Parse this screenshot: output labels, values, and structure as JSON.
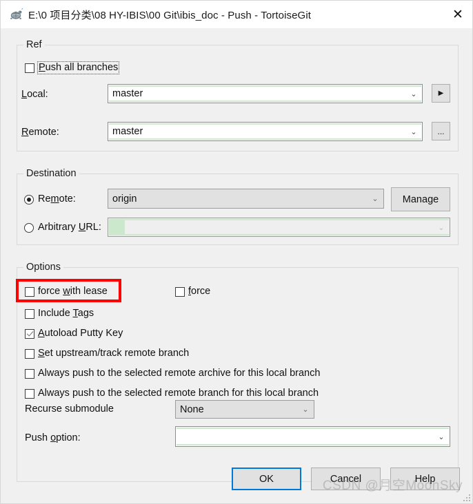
{
  "window": {
    "title": "E:\\0 项目分类\\08 HY-IBIS\\00 Git\\ibis_doc - Push - TortoiseGit",
    "app_icon": "tortoisegit-turtle-icon",
    "close_label": "✕"
  },
  "ref_group": {
    "title": "Ref",
    "push_all_branches": {
      "label": "Push all branches",
      "accel": "P",
      "checked": false,
      "focused": true
    },
    "local": {
      "label": "Local:",
      "accel": "L",
      "value": "master",
      "arrow": "⌄"
    },
    "local_browse_button": {
      "glyph": "▶",
      "name": "local-branch-picker-button"
    },
    "remote": {
      "label": "Remote:",
      "accel": "R",
      "value": "master",
      "arrow": "⌄"
    },
    "remote_browse_button": {
      "glyph": "...",
      "name": "remote-branch-browse-button"
    }
  },
  "destination_group": {
    "title": "Destination",
    "remote_radio": {
      "label": "Remote:",
      "accel": "m",
      "selected": true
    },
    "remote_combo": {
      "value": "origin",
      "arrow": "⌄",
      "disabled": true
    },
    "manage_button": {
      "label": "Manage",
      "accel": "g"
    },
    "arbitrary_url_radio": {
      "label": "Arbitrary URL:",
      "accel": "U",
      "selected": false
    },
    "arbitrary_url_combo": {
      "value": "",
      "arrow": "⌄",
      "disabled": true
    }
  },
  "options_group": {
    "title": "Options",
    "checkboxes": [
      {
        "label": "force with lease",
        "accel": "w",
        "checked": false,
        "highlighted": true
      },
      {
        "label": "force",
        "accel": "f",
        "checked": false,
        "highlighted": false
      },
      {
        "label": "Include Tags",
        "accel": "T",
        "checked": false,
        "highlighted": false
      },
      {
        "label": "Autoload Putty Key",
        "accel": "A",
        "checked": true,
        "highlighted": false
      },
      {
        "label": "Set upstream/track remote branch",
        "accel": "S",
        "checked": false,
        "highlighted": false
      },
      {
        "label": "Always push to the selected remote archive for this local branch",
        "accel": "",
        "checked": false,
        "highlighted": false
      },
      {
        "label": "Always push to the selected remote branch for this local branch",
        "accel": "",
        "checked": false,
        "highlighted": false
      }
    ],
    "recurse_submodule": {
      "label": "Recurse submodule",
      "value": "None",
      "arrow": "⌄",
      "disabled": true
    },
    "push_option": {
      "label": "Push option:",
      "accel": "o",
      "value": "",
      "arrow": "⌄"
    }
  },
  "buttons": {
    "ok": "OK",
    "cancel": "Cancel",
    "help": "Help"
  },
  "watermark": {
    "text": "CSDN @月空MoonSky"
  },
  "colors": {
    "dialog_bg": "#f0f0f0",
    "accent_focus": "#0078d7",
    "annotation_red": "#ff0000",
    "field_green": "#cbe8cc",
    "disabled_fill": "#e1e1e1"
  }
}
